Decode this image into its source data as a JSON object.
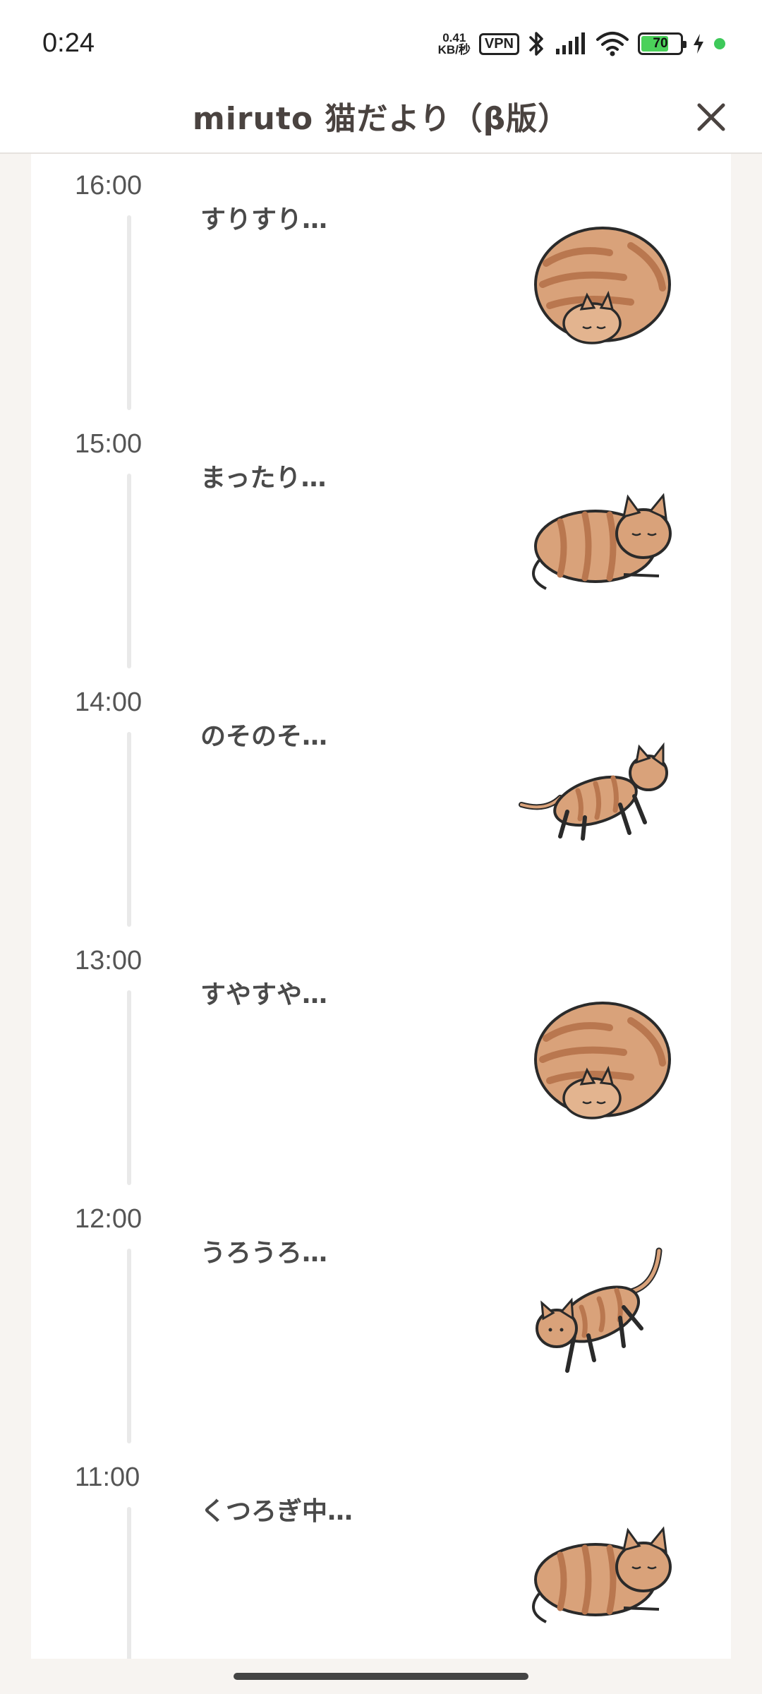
{
  "status_bar": {
    "time": "0:24",
    "net_speed_value": "0.41",
    "net_speed_unit": "KB/秒",
    "vpn_label": "VPN",
    "battery_level": "70",
    "icons": [
      "bluetooth-icon",
      "signal-icon",
      "wifi-icon",
      "battery-icon",
      "charging-icon"
    ]
  },
  "header": {
    "title": "miruto 猫だより（β版）",
    "close_icon": "close-icon"
  },
  "timeline": {
    "entries": [
      {
        "time": "16:00",
        "status": "すりすり…",
        "cat_pose": "curled"
      },
      {
        "time": "15:00",
        "status": "まったり…",
        "cat_pose": "lying"
      },
      {
        "time": "14:00",
        "status": "のそのそ…",
        "cat_pose": "sneaking"
      },
      {
        "time": "13:00",
        "status": "すやすや…",
        "cat_pose": "curled"
      },
      {
        "time": "12:00",
        "status": "うろうろ…",
        "cat_pose": "walking"
      },
      {
        "time": "11:00",
        "status": "くつろぎ中…",
        "cat_pose": "lying"
      }
    ]
  },
  "colors": {
    "background": "#f7f4f1",
    "card": "#ffffff",
    "cat_fur": "#d9a27a",
    "cat_stripe": "#b9774f",
    "battery": "#4bd15a"
  }
}
